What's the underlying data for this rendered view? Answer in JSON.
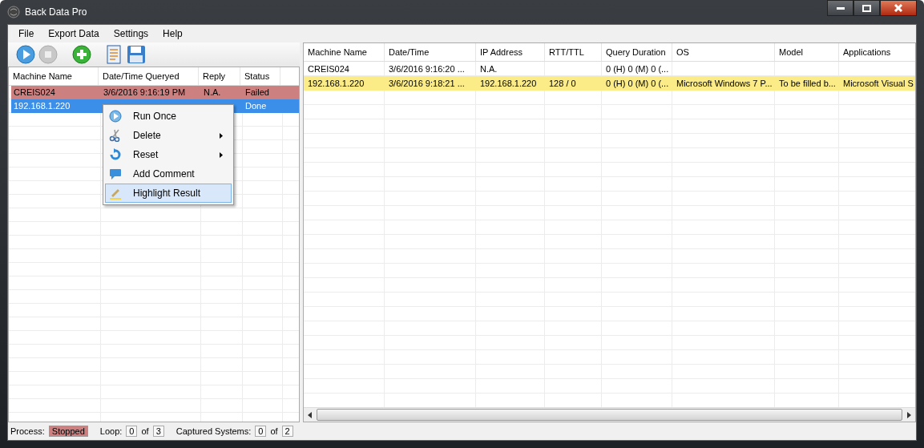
{
  "window": {
    "title": "Back Data Pro"
  },
  "menu": [
    "File",
    "Export Data",
    "Settings",
    "Help"
  ],
  "left_table": {
    "columns": [
      "Machine Name",
      "Date/Time Queryed",
      "Reply",
      "Status"
    ],
    "rows": [
      {
        "machine": "CREIS024",
        "date": "3/6/2016 9:16:19 PM",
        "reply": "N.A.",
        "status": "Failed",
        "kind": "failed",
        "selected": false
      },
      {
        "machine": "192.168.1.220",
        "status": "Done",
        "kind": "done",
        "selected": true
      }
    ]
  },
  "context_menu": [
    {
      "label": "Run Once",
      "submenu": false,
      "selected": false,
      "kind": "play"
    },
    {
      "label": "Delete",
      "submenu": true,
      "selected": false,
      "kind": "scissors"
    },
    {
      "label": "Reset",
      "submenu": true,
      "selected": false,
      "kind": "reset"
    },
    {
      "label": "Add Comment",
      "submenu": false,
      "selected": false,
      "kind": "comment"
    },
    {
      "label": "Highlight Result",
      "submenu": false,
      "selected": true,
      "kind": "pen"
    }
  ],
  "right_table": {
    "columns": [
      "Machine Name",
      "Date/Time",
      "IP Address",
      "RTT/TTL",
      "Query Duration",
      "OS",
      "Model",
      "Applications"
    ],
    "rows": [
      {
        "highlighted": false,
        "cells": [
          "CREIS024",
          "3/6/2016 9:16:20 ...",
          "N.A.",
          "",
          "0 (H) 0 (M) 0 (...",
          "",
          "",
          ""
        ]
      },
      {
        "highlighted": true,
        "cells": [
          "192.168.1.220",
          "3/6/2016 9:18:21 ...",
          "192.168.1.220",
          "128 / 0",
          "0 (H) 0 (M) 0 (...",
          "Microsoft Windows 7 P...",
          "To be filled b...",
          "Microsoft Visual S"
        ]
      }
    ]
  },
  "status_bar": {
    "process_label": "Process:",
    "process": "Stopped",
    "loop_label": "Loop:",
    "loop": "0",
    "of1": "of",
    "loop_total": "3",
    "captured_label": "Captured Systems:",
    "captured": "0",
    "of2": "of",
    "captured_total": "2"
  }
}
